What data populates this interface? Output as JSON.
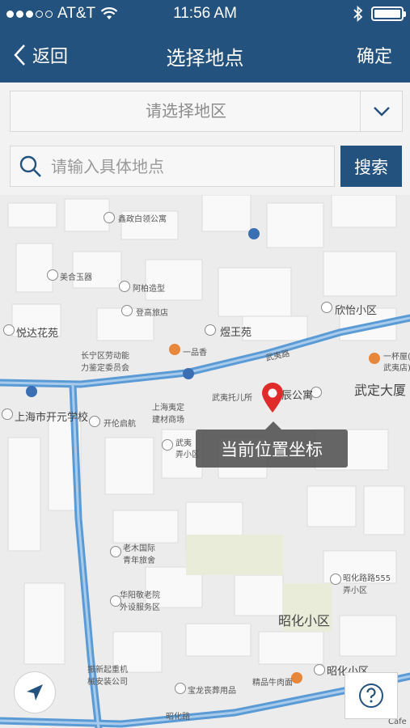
{
  "status": {
    "carrier": "AT&T",
    "time": "11:56 AM"
  },
  "nav": {
    "back_label": "返回",
    "title": "选择地点",
    "confirm_label": "确定"
  },
  "region": {
    "placeholder": "请选择地区"
  },
  "search": {
    "placeholder": "请输入具体地点",
    "button_label": "搜索"
  },
  "map": {
    "labels": [
      "鑫政白领公寓",
      "美合玉器",
      "阿柏造型",
      "登高旅店",
      "悦达花苑",
      "煜王苑",
      "一品香",
      "长宁区劳动能",
      "力鉴定委员会",
      "欣怡小区",
      "一杯屋(",
      "武夷店)",
      "武定大厦",
      "武夷托儿所",
      "辰公寓",
      "上海市开元学校",
      "开伦启航",
      "上海夷定",
      "建材商场",
      "武夷",
      "弄小区",
      "老木国际",
      "青年旅舍",
      "华阳敬老院",
      "外设服务区",
      "昭化路路555",
      "弄小区",
      "昭化小区",
      "昭化小区",
      "精品牛肉面",
      "振新起重机",
      "械安装公司",
      "宝龙丧葬用品",
      "昭化路",
      "武夷路",
      "Cafe"
    ],
    "tooltip": "当前位置坐标"
  },
  "colors": {
    "primary": "#24527f",
    "road": "#5b9bd5",
    "pin": "#e02b2b"
  }
}
